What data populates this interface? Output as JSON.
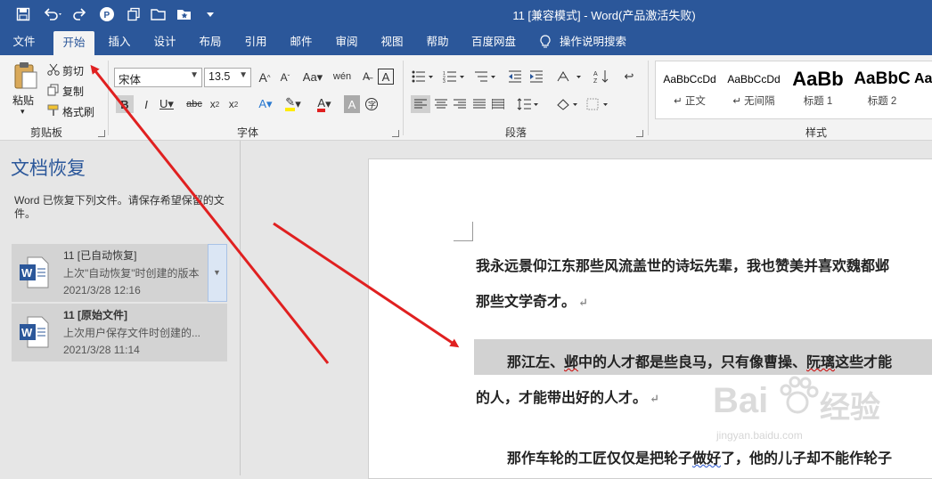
{
  "titlebar": {
    "title": "11 [兼容模式] - Word(产品激活失败)"
  },
  "tabs": [
    "文件",
    "开始",
    "插入",
    "设计",
    "布局",
    "引用",
    "邮件",
    "审阅",
    "视图",
    "帮助",
    "百度网盘",
    "操作说明搜索"
  ],
  "ribbon": {
    "clipboard": {
      "paste": "粘贴",
      "cut": "剪切",
      "copy": "复制",
      "format_painter": "格式刷",
      "group": "剪贴板"
    },
    "font": {
      "font_name": "宋体",
      "font_size": "13.5",
      "group": "字体"
    },
    "paragraph": {
      "group": "段落"
    },
    "styles": {
      "group": "样式",
      "items": [
        {
          "preview": "AaBbCcDd",
          "name": "↵ 正文"
        },
        {
          "preview": "AaBbCcDd",
          "name": "↵ 无间隔"
        },
        {
          "preview": "AaBb",
          "name": "标题 1"
        },
        {
          "preview": "AaBbC",
          "name": "标题 2"
        },
        {
          "preview": "Aa",
          "name": ""
        }
      ]
    }
  },
  "recovery": {
    "title": "文档恢复",
    "description": "Word 已恢复下列文件。请保存希望保留的文件。",
    "files": [
      {
        "name": "11  [已自动恢复]",
        "subtitle": "上次\"自动恢复\"时创建的版本",
        "date": "2021/3/28 12:16"
      },
      {
        "name": "11  [原始文件]",
        "subtitle": "上次用户保存文件时创建的...",
        "date": "2021/3/28 11:14"
      }
    ]
  },
  "document": {
    "line1": "我永远景仰江东那些风流盖世的诗坛先辈，我也赞美并喜欢魏都邺",
    "line2": "那些文学奇才。",
    "line3a": "那江左、",
    "line3b": "邺",
    "line3c": "中的人才都是些良马，只有像曹操、",
    "line3d": "阮璃",
    "line3e": "这些才能",
    "line4": "的人，才能带出好的人才。",
    "line5a": "那作车轮的工匠仅仅是把轮子",
    "line5b": "做好",
    "line5c": "了，他的儿子却不能作轮子"
  },
  "watermark": {
    "brand": "Bai",
    "brand2": "经验",
    "url": "jingyan.baidu.com"
  },
  "colors": {
    "accent": "#2b579a",
    "arrow": "#e02020"
  }
}
